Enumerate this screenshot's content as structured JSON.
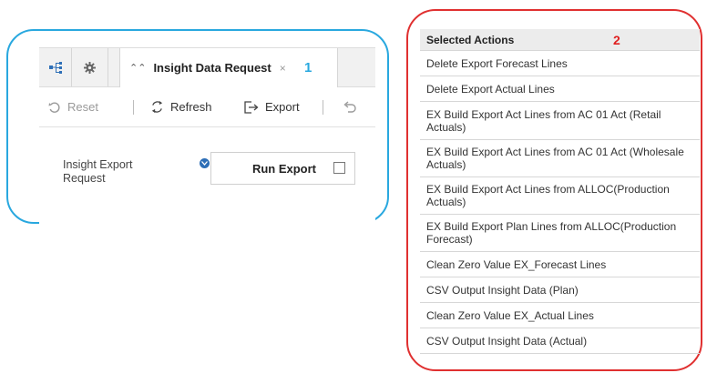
{
  "callout1": {
    "number": "1",
    "tab": {
      "label": "Insight Data Request",
      "close": "×",
      "expand": "≫"
    },
    "toolbar": {
      "reset_label": "Reset",
      "refresh_label": "Refresh",
      "export_label": "Export"
    },
    "form": {
      "label": "Insight Export Request",
      "run_label": "Run Export",
      "checked": false
    }
  },
  "callout2": {
    "number": "2",
    "header": "Selected Actions",
    "items": [
      "Delete Export Forecast Lines",
      "Delete Export Actual Lines",
      "EX Build Export Act Lines from AC 01 Act (Retail Actuals)",
      "EX Build Export Act Lines from AC 01 Act (Wholesale Actuals)",
      "EX Build Export Act Lines from ALLOC(Production Actuals)",
      "EX Build Export Plan Lines from ALLOC(Production Forecast)",
      "Clean Zero Value EX_Forecast Lines",
      "CSV Output Insight Data (Plan)",
      "Clean Zero Value EX_Actual Lines",
      "CSV Output Insight Data (Actual)"
    ]
  },
  "colors": {
    "callout1_border": "#29a8df",
    "callout2_border": "#e03030",
    "info_icon": "#2e6fb7"
  },
  "icons": [
    "hierarchy-icon",
    "gear-icon",
    "expand-icon",
    "close-icon",
    "reset-icon",
    "refresh-icon",
    "export-icon",
    "undo-icon",
    "info-icon",
    "checkbox"
  ]
}
